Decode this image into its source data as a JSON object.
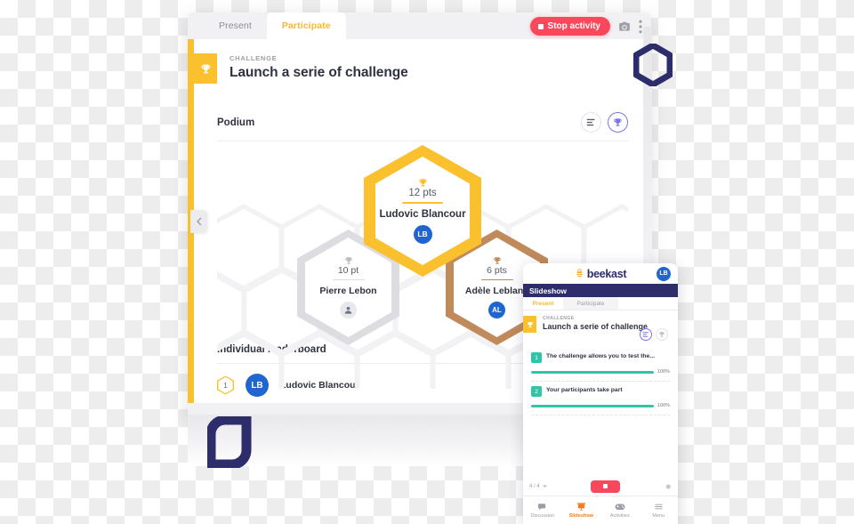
{
  "desktop": {
    "tabs": [
      {
        "id": "present",
        "label": "Present",
        "active": false
      },
      {
        "id": "participate",
        "label": "Participate",
        "active": true
      }
    ],
    "actions": {
      "stop_label": "Stop activity",
      "camera_icon": "camera-icon",
      "more_icon": "more-vertical-icon"
    },
    "challenge": {
      "kicker": "CHALLENGE",
      "title": "Launch a serie of challenge",
      "badge_icon": "trophy-icon"
    },
    "podium": {
      "title": "Podium",
      "toggles": [
        {
          "id": "list",
          "icon": "list-bars-icon",
          "active": false
        },
        {
          "id": "trophy",
          "icon": "trophy-icon",
          "active": true
        }
      ],
      "places": [
        {
          "rank": 1,
          "points": "12 pts",
          "name": "Ludovic Blancour",
          "initials": "LB",
          "avatar_color": "#1f66d0",
          "ring_color": "#fbc02d"
        },
        {
          "rank": 2,
          "points": "10 pt",
          "name": "Pierre Lebon",
          "initials": "",
          "avatar_color": "#e8e8ec",
          "ring_color": "#dcdce1"
        },
        {
          "rank": 3,
          "points": "6 pts",
          "name": "Adèle Leblanc",
          "initials": "AL",
          "avatar_color": "#1f66d0",
          "ring_color": "#c08a5a"
        }
      ]
    },
    "leaderboard": {
      "title": "Individual leaderboard",
      "rows": [
        {
          "rank": "1",
          "name": "Ludovic Blancour",
          "initials": "LB",
          "avatar_color": "#1f66d0"
        }
      ]
    }
  },
  "mobile": {
    "brand": "beekast",
    "brand_icon": "bee-icon",
    "avatar_initials": "LB",
    "section_title": "Slideshow",
    "tabs": [
      {
        "id": "present",
        "label": "Present",
        "active": true
      },
      {
        "id": "participate",
        "label": "Participate",
        "active": false
      }
    ],
    "challenge": {
      "kicker": "CHALLENGE",
      "title": "Launch a serie of challenge",
      "badge_icon": "trophy-icon"
    },
    "toggles": [
      {
        "id": "list",
        "icon": "list-bars-icon",
        "active": true
      },
      {
        "id": "trophy",
        "icon": "trophy-icon",
        "active": false
      }
    ],
    "questions": [
      {
        "num": "1",
        "text": "The challenge allows you to test the...",
        "percent": "100%",
        "value": 100
      },
      {
        "num": "2",
        "text": "Your participants take part",
        "percent": "100%",
        "value": 100
      }
    ],
    "controls": {
      "page_count": "4 / 4",
      "stop_label": "",
      "settings_icon": "gear-icon"
    },
    "bottom_nav": [
      {
        "id": "discussion",
        "label": "Discussion",
        "icon": "chat-icon",
        "active": false
      },
      {
        "id": "slideshow",
        "label": "Slideshow",
        "icon": "presentation-icon",
        "active": true
      },
      {
        "id": "activities",
        "label": "Activities",
        "icon": "gamepad-icon",
        "active": false
      },
      {
        "id": "menu",
        "label": "Menu",
        "icon": "hamburger-icon",
        "active": false
      }
    ]
  },
  "decor": {
    "hex_logo": "hexagon-outline-logo",
    "leaf_logo": "leaf-logo"
  },
  "colors": {
    "yellow": "#fbc02d",
    "red": "#f9485b",
    "navy": "#2e2d6b",
    "teal": "#2fc6a8",
    "purple": "#7b74e8",
    "orange": "#f47b20"
  }
}
